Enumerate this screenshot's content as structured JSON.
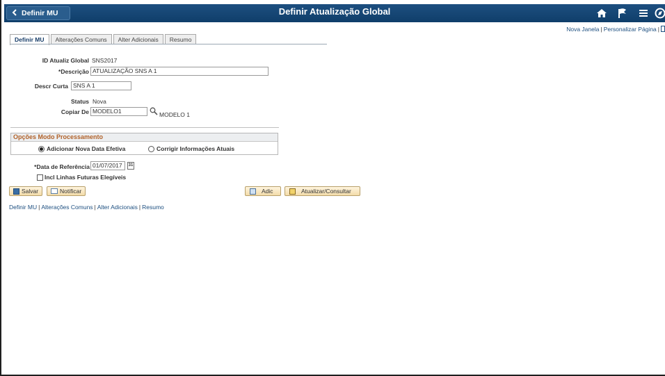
{
  "header": {
    "back_label": "Definir MU",
    "title": "Definir Atualização Global",
    "icons": [
      "home-icon",
      "flag-icon",
      "menu-icon",
      "navigator-icon"
    ]
  },
  "top_links": {
    "new_window": "Nova Janela",
    "personalize": "Personalizar Página",
    "sep": "|"
  },
  "tabs": [
    {
      "label": "Definir MU",
      "active": true
    },
    {
      "label": "Alterações Comuns",
      "active": false
    },
    {
      "label": "Alter Adicionais",
      "active": false
    },
    {
      "label": "Resumo",
      "active": false
    }
  ],
  "form": {
    "id_label": "ID Atualiz Global",
    "id_value": "SNS2017",
    "descr_label": "*Descrição",
    "descr_value": "ATUALIZAÇÃO SNS A 1",
    "short_label": "Descr Curta",
    "short_value": "SNS A 1",
    "status_label": "Status",
    "status_value": "Nova",
    "copy_label": "Copiar De",
    "copy_value": "MODELO1",
    "copy_descr": "MODELO 1"
  },
  "processing": {
    "title": "Opções Modo Processamento",
    "option1": "Adicionar Nova Data Efetiva",
    "option2": "Corrigir Informações Atuais",
    "selected": "option1"
  },
  "date": {
    "label": "*Data de Referência",
    "value": "01/07/2017",
    "calendar_text": "31"
  },
  "checkbox": {
    "label": "Incl Linhas Futuras Elegíveis",
    "checked": false
  },
  "buttons": {
    "save": "Salvar",
    "notify": "Notificar",
    "add": "Adic",
    "update": "Atualizar/Consultar"
  },
  "bottom_links": [
    "Definir MU",
    "Alterações Comuns",
    "Alter Adicionais",
    "Resumo"
  ],
  "colors": {
    "header_bg": "#0f3e6a",
    "link": "#1d4f80",
    "group_title": "#b1622a",
    "button_bg": "#f3dcaa"
  }
}
